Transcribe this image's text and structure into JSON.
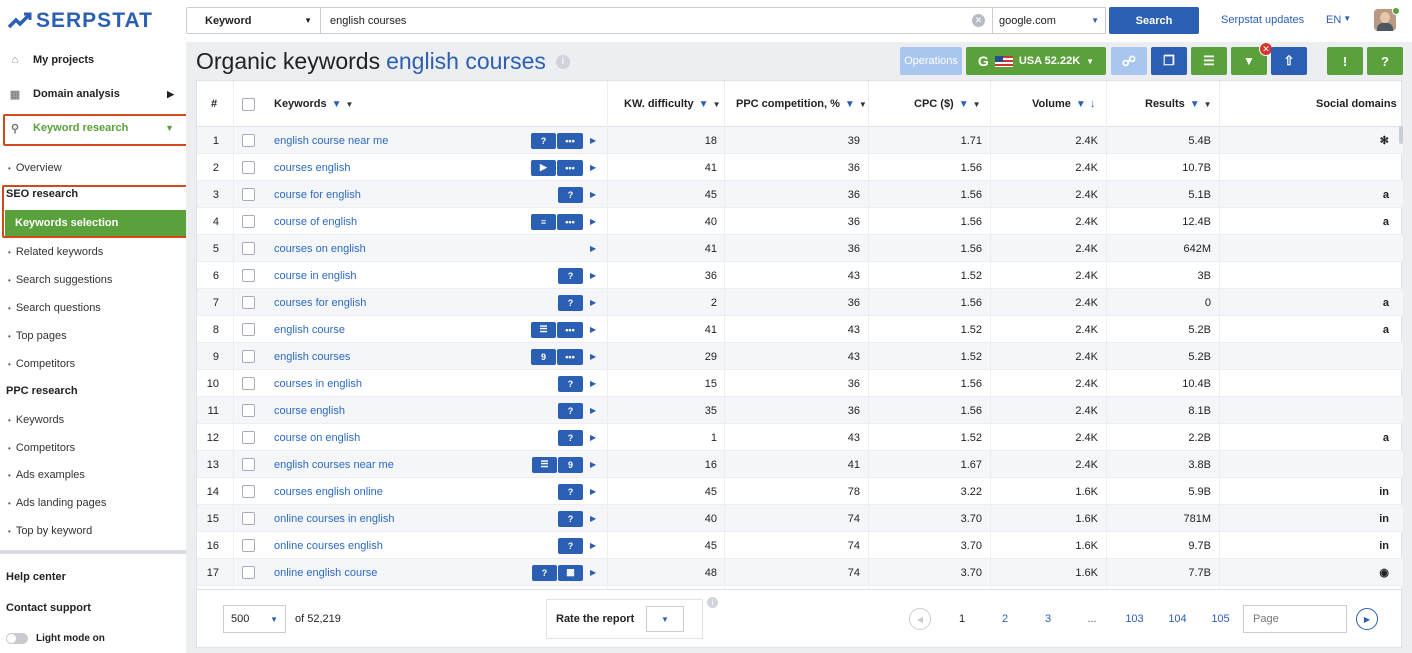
{
  "brand": {
    "name": "SERPSTAT"
  },
  "sidebar": {
    "my_projects": "My projects",
    "domain_analysis": "Domain analysis",
    "keyword_research": "Keyword research",
    "overview": "Overview",
    "seo_research": "SEO research",
    "keywords_selection": "Keywords selection",
    "seo_items": [
      "Related keywords",
      "Search suggestions",
      "Search questions",
      "Top pages",
      "Competitors"
    ],
    "ppc_research": "PPC research",
    "ppc_items": [
      "Keywords",
      "Competitors",
      "Ads examples",
      "Ads landing pages",
      "Top by keyword"
    ],
    "help_center": "Help center",
    "contact_support": "Contact support",
    "light_mode": "Light mode on"
  },
  "search": {
    "type": "Keyword",
    "query": "english courses",
    "database": "google.com",
    "button": "Search"
  },
  "header": {
    "updates": "Serpstat updates",
    "lang": "EN"
  },
  "page": {
    "title": "Organic keywords",
    "query": "english courses",
    "operations": "Operations",
    "region": "USA 52.22K"
  },
  "columns": {
    "num": "#",
    "keywords": "Keywords",
    "kd": "KW. difficulty",
    "ppc": "PPC competition, %",
    "cpc": "CPC ($)",
    "volume": "Volume",
    "results": "Results",
    "social": "Social domains"
  },
  "rows": [
    {
      "n": "1",
      "kw": "english course near me",
      "kd": "18",
      "ppc": "39",
      "cpc": "1.71",
      "vol": "2.4K",
      "res": "5.4B",
      "badges": [
        "?",
        "•••"
      ],
      "social": "yelp-icon"
    },
    {
      "n": "2",
      "kw": "courses english",
      "kd": "41",
      "ppc": "36",
      "cpc": "1.56",
      "vol": "2.4K",
      "res": "10.7B",
      "badges": [
        "video",
        "•••"
      ],
      "social": ""
    },
    {
      "n": "3",
      "kw": "course for english",
      "kd": "45",
      "ppc": "36",
      "cpc": "1.56",
      "vol": "2.4K",
      "res": "5.1B",
      "badges": [
        "?"
      ],
      "social": "amazon-icon"
    },
    {
      "n": "4",
      "kw": "course of english",
      "kd": "40",
      "ppc": "36",
      "cpc": "1.56",
      "vol": "2.4K",
      "res": "12.4B",
      "badges": [
        "list",
        "•••"
      ],
      "social": "amazon-icon"
    },
    {
      "n": "5",
      "kw": "courses on english",
      "kd": "41",
      "ppc": "36",
      "cpc": "1.56",
      "vol": "2.4K",
      "res": "642M",
      "badges": [],
      "social": ""
    },
    {
      "n": "6",
      "kw": "course in english",
      "kd": "36",
      "ppc": "43",
      "cpc": "1.52",
      "vol": "2.4K",
      "res": "3B",
      "badges": [
        "?"
      ],
      "social": ""
    },
    {
      "n": "7",
      "kw": "courses for english",
      "kd": "2",
      "ppc": "36",
      "cpc": "1.56",
      "vol": "2.4K",
      "res": "0",
      "badges": [
        "?"
      ],
      "social": "amazon-icon"
    },
    {
      "n": "8",
      "kw": "english course",
      "kd": "41",
      "ppc": "43",
      "cpc": "1.52",
      "vol": "2.4K",
      "res": "5.2B",
      "badges": [
        "menu",
        "•••"
      ],
      "social": "amazon-icon"
    },
    {
      "n": "9",
      "kw": "english courses",
      "kd": "29",
      "ppc": "43",
      "cpc": "1.52",
      "vol": "2.4K",
      "res": "5.2B",
      "badges": [
        "pin",
        "•••"
      ],
      "social": ""
    },
    {
      "n": "10",
      "kw": "courses in english",
      "kd": "15",
      "ppc": "36",
      "cpc": "1.56",
      "vol": "2.4K",
      "res": "10.4B",
      "badges": [
        "?"
      ],
      "social": ""
    },
    {
      "n": "11",
      "kw": "course english",
      "kd": "35",
      "ppc": "36",
      "cpc": "1.56",
      "vol": "2.4K",
      "res": "8.1B",
      "badges": [
        "?"
      ],
      "social": ""
    },
    {
      "n": "12",
      "kw": "course on english",
      "kd": "1",
      "ppc": "43",
      "cpc": "1.52",
      "vol": "2.4K",
      "res": "2.2B",
      "badges": [
        "?"
      ],
      "social": "amazon-icon"
    },
    {
      "n": "13",
      "kw": "english courses near me",
      "kd": "16",
      "ppc": "41",
      "cpc": "1.67",
      "vol": "2.4K",
      "res": "3.8B",
      "badges": [
        "menu",
        "pin"
      ],
      "social": ""
    },
    {
      "n": "14",
      "kw": "courses english online",
      "kd": "45",
      "ppc": "78",
      "cpc": "3.22",
      "vol": "1.6K",
      "res": "5.9B",
      "badges": [
        "?"
      ],
      "social": "linkedin-icon"
    },
    {
      "n": "15",
      "kw": "online courses in english",
      "kd": "40",
      "ppc": "74",
      "cpc": "3.70",
      "vol": "1.6K",
      "res": "781M",
      "badges": [
        "?"
      ],
      "social": "linkedin-icon"
    },
    {
      "n": "16",
      "kw": "online courses english",
      "kd": "45",
      "ppc": "74",
      "cpc": "3.70",
      "vol": "1.6K",
      "res": "9.7B",
      "badges": [
        "?"
      ],
      "social": "linkedin-icon"
    },
    {
      "n": "17",
      "kw": "online english course",
      "kd": "48",
      "ppc": "74",
      "cpc": "3.70",
      "vol": "1.6K",
      "res": "7.7B",
      "badges": [
        "?",
        "shop"
      ],
      "social": "instagram-icon"
    }
  ],
  "footer": {
    "per_page": "500",
    "total": "of 52,219",
    "rate": "Rate the report",
    "pages": [
      "1",
      "2",
      "3",
      "...",
      "103",
      "104",
      "105"
    ],
    "page_placeholder": "Page"
  }
}
